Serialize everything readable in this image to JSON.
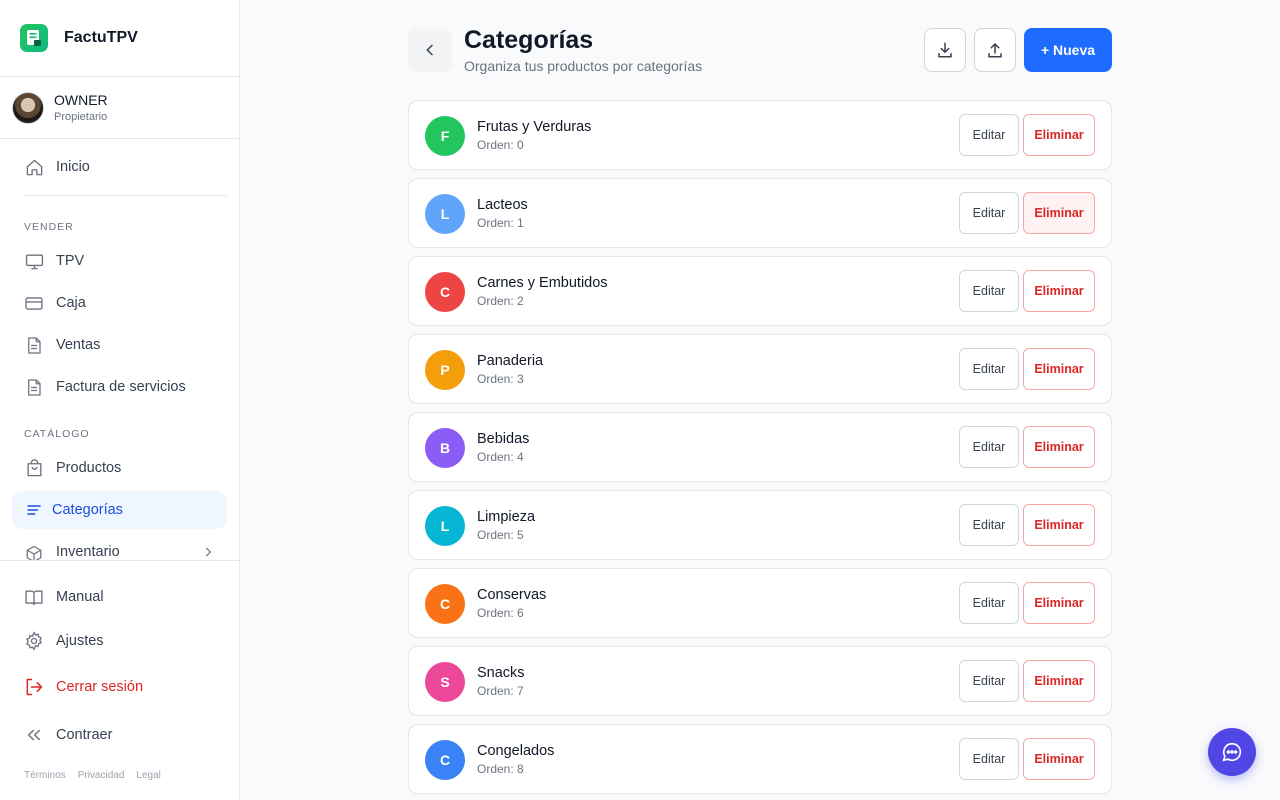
{
  "app": {
    "name": "FactuTPV"
  },
  "user": {
    "name": "OWNER",
    "role": "Propietario"
  },
  "sidebar": {
    "home": {
      "label": "Inicio",
      "icon": "home-icon"
    },
    "sections": [
      {
        "title": "VENDER",
        "items": [
          {
            "label": "TPV",
            "icon": "monitor-icon"
          },
          {
            "label": "Caja",
            "icon": "credit-card-icon"
          },
          {
            "label": "Ventas",
            "icon": "document-icon"
          },
          {
            "label": "Factura de servicios",
            "icon": "document-icon"
          }
        ]
      },
      {
        "title": "CATÁLOGO",
        "items": [
          {
            "label": "Productos",
            "icon": "shopping-bag-icon"
          },
          {
            "label": "Categorías",
            "icon": "list-icon",
            "active": true
          },
          {
            "label": "Inventario",
            "icon": "cube-icon"
          }
        ]
      }
    ],
    "bottom": {
      "manual": "Manual",
      "settings": "Ajustes",
      "logout": "Cerrar sesión",
      "collapse": "Contraer"
    },
    "footer_links": [
      "Términos",
      "Privacidad",
      "Legal"
    ]
  },
  "page": {
    "title": "Categorías",
    "subtitle": "Organiza tus productos por categorías",
    "new_label": "+ Nueva"
  },
  "row_labels": {
    "edit": "Editar",
    "delete": "Eliminar"
  },
  "categories": [
    {
      "initial": "F",
      "name": "Frutas y Verduras",
      "order": "Orden: 0",
      "color": "#22c55e"
    },
    {
      "initial": "L",
      "name": "Lacteos",
      "order": "Orden: 1",
      "color": "#60a5fa"
    },
    {
      "initial": "C",
      "name": "Carnes y Embutidos",
      "order": "Orden: 2",
      "color": "#ef4444"
    },
    {
      "initial": "P",
      "name": "Panaderia",
      "order": "Orden: 3",
      "color": "#f59e0b"
    },
    {
      "initial": "B",
      "name": "Bebidas",
      "order": "Orden: 4",
      "color": "#8b5cf6"
    },
    {
      "initial": "L",
      "name": "Limpieza",
      "order": "Orden: 5",
      "color": "#06b6d4"
    },
    {
      "initial": "C",
      "name": "Conservas",
      "order": "Orden: 6",
      "color": "#f97316"
    },
    {
      "initial": "S",
      "name": "Snacks",
      "order": "Orden: 7",
      "color": "#ec4899"
    },
    {
      "initial": "C",
      "name": "Congelados",
      "order": "Orden: 8",
      "color": "#3b82f6"
    }
  ],
  "colors": {
    "accent": "#1d6bff",
    "active_nav": "#1d4ed8",
    "danger": "#dc2626",
    "chat": "#4f46e5"
  }
}
